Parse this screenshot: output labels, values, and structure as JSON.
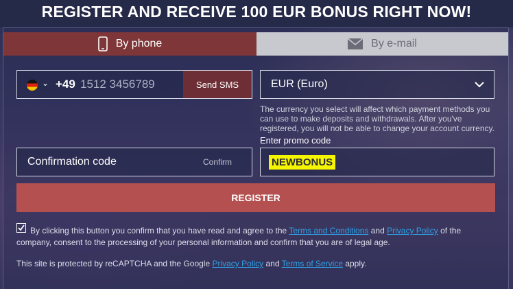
{
  "headline": "REGISTER AND RECEIVE 100 EUR BONUS RIGHT NOW!",
  "tabs": [
    {
      "label": "By phone",
      "icon": "phone-icon",
      "active": true
    },
    {
      "label": "By e-mail",
      "icon": "envelope-icon",
      "active": false
    }
  ],
  "phone": {
    "country_flag": "germany-flag-icon",
    "dial_code": "+49",
    "placeholder": "1512 3456789",
    "send_sms_label": "Send SMS"
  },
  "currency": {
    "selected": "EUR (Euro)",
    "note": "The currency you select will affect which payment methods you can use to make deposits and withdrawals. After you've registered, you will not be able to change your account currency."
  },
  "confirmation": {
    "label": "Confirmation code",
    "confirm_label": "Confirm"
  },
  "promo": {
    "label": "Enter promo code",
    "value": "NEWBONUS"
  },
  "register_label": "REGISTER",
  "consent": {
    "checked": true,
    "text_1": "By clicking this button you confirm that you have read and agree to the ",
    "terms_link": "Terms and Conditions",
    "text_2": " and ",
    "privacy_link": "Privacy Policy",
    "text_3": " of the company, consent to the processing of your personal information and confirm that you are of legal age."
  },
  "recaptcha": {
    "text_1": "This site is protected by reCAPTCHA and the Google ",
    "privacy_link": "Privacy Policy",
    "text_2": " and ",
    "terms_link": "Terms of Service",
    "text_3": " apply."
  },
  "colors": {
    "active_tab": "#7e3638",
    "register_button": "#b45150",
    "link": "#2fa2e8",
    "promo_highlight": "#f5f500"
  }
}
